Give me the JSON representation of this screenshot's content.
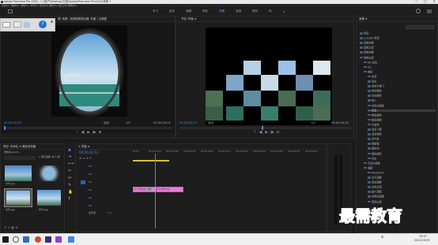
{
  "titlebar": {
    "title": "Adobe Premiere Pro 2020 - C:\\用户\\Desktop\\文档\\Adobe\\Premiere Pro\\14.0\\未命 *",
    "min": "—",
    "max": "□",
    "close": "✕"
  },
  "menu": [
    "文件(F)",
    "编辑(E)",
    "剪辑(C)",
    "序列(S)",
    "标记(M)",
    "图形(G)",
    "窗口(W)",
    "帮助(H)"
  ],
  "workspaces": [
    {
      "label": "学习",
      "active": false
    },
    {
      "label": "组件",
      "active": false
    },
    {
      "label": "编辑",
      "active": false
    },
    {
      "label": "颜色",
      "active": false
    },
    {
      "label": "效果",
      "active": true
    },
    {
      "label": "音频",
      "active": false
    },
    {
      "label": "图形",
      "active": false
    },
    {
      "label": "库",
      "active": false
    }
  ],
  "source_monitor": {
    "tabs": "源: 效果  |  音频剪辑混合器: 时装  |  元数据",
    "timecode_left": "00;00;00;00",
    "fit": "适合",
    "ratio": "1/2",
    "timecode_right": "00;00;05;00"
  },
  "program_monitor": {
    "title": "节目: 时装 ≡",
    "timecode_left": "00;00;02;13",
    "fit": "适合",
    "ratio": "1/2",
    "timecode_right": "00;00;04;20"
  },
  "project_panel": {
    "tabs": "项目: 未命名 ≡   媒体浏览器",
    "file": "未命名.prproj",
    "count": "1 项已选择, 共 5 项",
    "items": [
      {
        "name": "大竹.jpg",
        "dur": "5;00"
      },
      {
        "name": "",
        "dur": ""
      },
      {
        "name": "大竹.jpg",
        "dur": "5;00"
      },
      {
        "name": "木竹.jpg",
        "dur": "5;00"
      }
    ]
  },
  "timeline": {
    "tab": "× 时装 ≡",
    "timecode": "00;00;02;13",
    "ruler": [
      "00;00",
      "00;00;05;00",
      "00;00;10;00",
      "00;00;15;00",
      "00;00;20;00",
      "00;00;25;00",
      "00;00;30;00",
      "00;00;35;00",
      "00;00;40;00",
      "00;00;45;00",
      "00;00;50;00"
    ],
    "video_tracks": [
      "V3",
      "V2",
      "V1"
    ],
    "audio_tracks": [
      "A1",
      "A2",
      "A3"
    ],
    "master": "主声道",
    "master_val": "0.0",
    "clip1": "fx 大竹.jpg",
    "clip1_tag": "交叉",
    "clip2": "fx 木竹.jpg"
  },
  "effects_panel": {
    "title": "效果 ≡",
    "search_placeholder": "",
    "tree": [
      {
        "label": "预设",
        "level": 0,
        "selected": false
      },
      {
        "label": "Lumetri 预设",
        "level": 0,
        "selected": false
      },
      {
        "label": "音频效果",
        "level": 0,
        "selected": false
      },
      {
        "label": "音频过渡",
        "level": 0,
        "selected": false
      },
      {
        "label": "视频效果",
        "level": 0,
        "selected": false
      },
      {
        "label": "视频过渡",
        "level": 0,
        "selected": false
      },
      {
        "label": "3D 运动",
        "level": 1,
        "selected": false
      },
      {
        "label": "Iris",
        "level": 1,
        "selected": false
      },
      {
        "label": "擦除",
        "level": 1,
        "selected": false
      },
      {
        "label": "内滑",
        "level": 2,
        "selected": false
      },
      {
        "label": "划出",
        "level": 2,
        "selected": false
      },
      {
        "label": "双侧平推门",
        "level": 2,
        "selected": false
      },
      {
        "label": "带状擦除",
        "level": 2,
        "selected": false
      },
      {
        "label": "径向擦除",
        "level": 2,
        "selected": false
      },
      {
        "label": "插入",
        "level": 2,
        "selected": false
      },
      {
        "label": "时钟式擦除",
        "level": 2,
        "selected": false
      },
      {
        "label": "棋盘",
        "level": 2,
        "selected": true
      },
      {
        "label": "棋盘擦除",
        "level": 2,
        "selected": false
      },
      {
        "label": "楔形擦除",
        "level": 2,
        "selected": false
      },
      {
        "label": "水波块",
        "level": 2,
        "selected": false
      },
      {
        "label": "油漆飞溅",
        "level": 2,
        "selected": false
      },
      {
        "label": "渐变擦除",
        "level": 2,
        "selected": false
      },
      {
        "label": "百叶窗",
        "level": 2,
        "selected": false
      },
      {
        "label": "螺旋框",
        "level": 2,
        "selected": false
      },
      {
        "label": "随机块",
        "level": 2,
        "selected": false
      },
      {
        "label": "随机擦除",
        "level": 2,
        "selected": false
      },
      {
        "label": "风车",
        "level": 2,
        "selected": false
      },
      {
        "label": "沉浸式视频",
        "level": 1,
        "selected": false
      },
      {
        "label": "溶解",
        "level": 1,
        "selected": false
      },
      {
        "label": "MorphCut",
        "level": 2,
        "selected": false
      },
      {
        "label": "交叉溶解",
        "level": 2,
        "selected": false
      },
      {
        "label": "叠加溶解",
        "level": 2,
        "selected": false
      },
      {
        "label": "白场过渡",
        "level": 2,
        "selected": false
      },
      {
        "label": "胶片溶解",
        "level": 2,
        "selected": false
      },
      {
        "label": "非叠加溶解",
        "level": 2,
        "selected": false
      },
      {
        "label": "黑场过渡",
        "level": 2,
        "selected": false
      }
    ]
  },
  "watermark": "最需教育",
  "taskbar": {
    "time": "15:47",
    "date": "2021/10/15",
    "lang": "中"
  }
}
